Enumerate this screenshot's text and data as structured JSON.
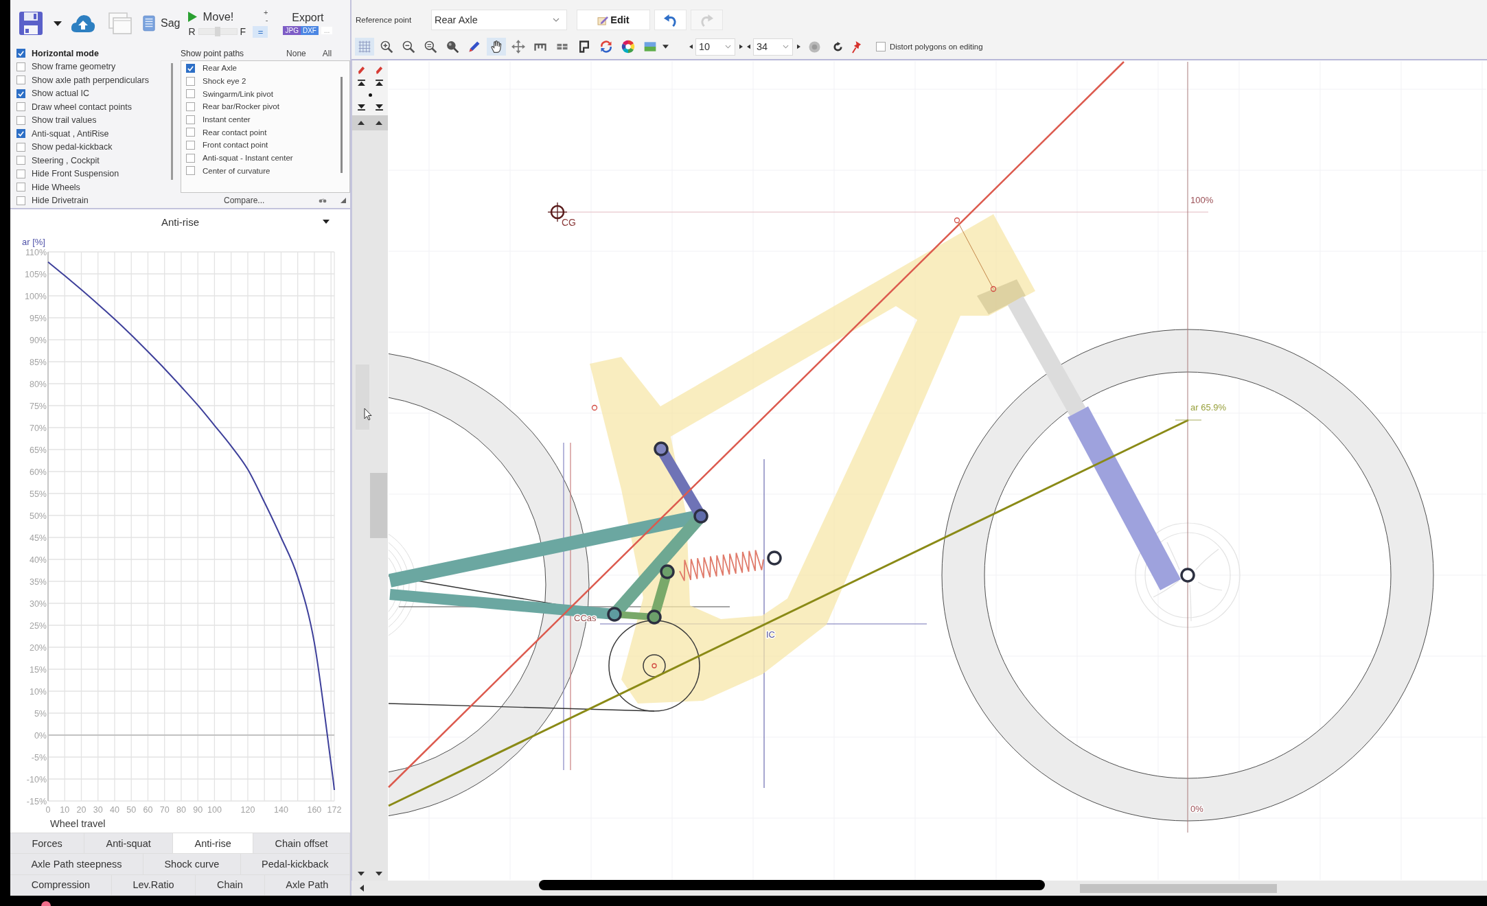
{
  "left_toolbar": {
    "sag_button": "Sag",
    "move_button": "Move!",
    "balance_slider": {
      "left_label": "R",
      "right_label": "F",
      "level": 0.5
    },
    "step_up": "+",
    "step_down": "-",
    "equal_button": "=",
    "export": {
      "label": "Export",
      "formats": [
        {
          "label": "JPG",
          "color": "#7d5cc6"
        },
        {
          "label": "DXF",
          "color": "#4b86e3"
        }
      ],
      "more_button": "..."
    }
  },
  "display_options": [
    {
      "label": "Horizontal mode",
      "checked": true,
      "bold": true
    },
    {
      "label": "Show frame geometry",
      "checked": false,
      "bold": false
    },
    {
      "label": "Show axle path perpendiculars",
      "checked": false,
      "bold": false
    },
    {
      "label": "Show actual IC",
      "checked": true,
      "bold": false
    },
    {
      "label": "Draw wheel contact points",
      "checked": false,
      "bold": false
    },
    {
      "label": "Show trail values",
      "checked": false,
      "bold": false
    },
    {
      "label": "Anti-squat , AntiRise",
      "checked": true,
      "bold": false
    },
    {
      "label": "Show pedal-kickback",
      "checked": false,
      "bold": false
    },
    {
      "label": "Steering , Cockpit",
      "checked": false,
      "bold": false
    },
    {
      "label": "Hide Front Suspension",
      "checked": false,
      "bold": false
    },
    {
      "label": "Hide Wheels",
      "checked": false,
      "bold": false
    },
    {
      "label": "Hide Drivetrain",
      "checked": false,
      "bold": false
    }
  ],
  "point_paths": {
    "title": "Show point paths",
    "none_button": "None",
    "all_button": "All",
    "items": [
      {
        "label": "Rear Axle",
        "checked": true
      },
      {
        "label": "Shock eye 2",
        "checked": false
      },
      {
        "label": "Swingarm/Link pivot",
        "checked": false
      },
      {
        "label": "Rear bar/Rocker pivot",
        "checked": false
      },
      {
        "label": "Instant center",
        "checked": false
      },
      {
        "label": "Rear contact point",
        "checked": false
      },
      {
        "label": "Front contact point",
        "checked": false
      },
      {
        "label": "Anti-squat - Instant center",
        "checked": false
      },
      {
        "label": "Center of curvature",
        "checked": false
      }
    ],
    "compare_button": "Compare..."
  },
  "reference_point": {
    "label": "Reference point",
    "value": "Rear Axle"
  },
  "edit_button": "Edit",
  "history_buttons": [
    {
      "kind": "undo",
      "disabled": false
    },
    {
      "kind": "redo",
      "disabled": true
    }
  ],
  "view_tools": [
    {
      "kind": "grid",
      "selected": true
    },
    {
      "kind": "zoomin",
      "selected": false
    },
    {
      "kind": "zoomout",
      "selected": false
    },
    {
      "kind": "zoomfit",
      "selected": false
    },
    {
      "kind": "zoomall",
      "selected": false
    },
    {
      "kind": "brush",
      "selected": false
    },
    {
      "kind": "hand",
      "selected": true
    },
    {
      "kind": "move",
      "selected": false
    },
    {
      "kind": "ruler",
      "selected": false
    },
    {
      "kind": "tiles",
      "selected": false
    },
    {
      "kind": "pattern",
      "selected": false
    },
    {
      "kind": "rotate",
      "selected": false
    },
    {
      "kind": "palette",
      "selected": false
    },
    {
      "kind": "image",
      "selected": false
    }
  ],
  "spin_fields": [
    {
      "value": "10"
    },
    {
      "value": "34"
    }
  ],
  "distort_polygons": {
    "label": "Distort polygons on editing",
    "checked": false
  },
  "graph_panel": {
    "chart_data": {
      "type": "line",
      "title": "Anti-rise",
      "xlabel": "Wheel travel",
      "ylabel": "ar [%]",
      "grid": true,
      "x": [
        0,
        10,
        20,
        30,
        40,
        50,
        60,
        70,
        80,
        90,
        100,
        110,
        120,
        130,
        140,
        150,
        160,
        170,
        172
      ],
      "values": [
        107.7,
        104.6,
        101.4,
        98.1,
        94.7,
        91.1,
        87.3,
        83.4,
        79.3,
        75.1,
        70.5,
        65.8,
        60.5,
        53,
        45,
        36,
        21,
        -6.5,
        -12.5
      ],
      "xlim": [
        0,
        172
      ],
      "ylim": [
        -15,
        110
      ],
      "xticks": [
        0,
        10,
        20,
        30,
        40,
        50,
        60,
        70,
        80,
        90,
        100,
        120,
        140,
        160,
        172
      ],
      "yticks": [
        {
          "value": 110,
          "label": "110%"
        },
        {
          "value": 105,
          "label": "105%"
        },
        {
          "value": 100,
          "label": "100%"
        },
        {
          "value": 95,
          "label": "95%"
        },
        {
          "value": 90,
          "label": "90%"
        },
        {
          "value": 85,
          "label": "85%"
        },
        {
          "value": 80,
          "label": "80%"
        },
        {
          "value": 75,
          "label": "75%"
        },
        {
          "value": 70,
          "label": "70%"
        },
        {
          "value": 65,
          "label": "65%"
        },
        {
          "value": 60,
          "label": "60%"
        },
        {
          "value": 55,
          "label": "55%"
        },
        {
          "value": 50,
          "label": "50%"
        },
        {
          "value": 45,
          "label": "45%"
        },
        {
          "value": 40,
          "label": "40%"
        },
        {
          "value": 35,
          "label": "35%"
        },
        {
          "value": 30,
          "label": "30%"
        },
        {
          "value": 25,
          "label": "25%"
        },
        {
          "value": 20,
          "label": "20%"
        },
        {
          "value": 15,
          "label": "15%"
        },
        {
          "value": 10,
          "label": "10%"
        },
        {
          "value": 5,
          "label": "5%"
        },
        {
          "value": 0,
          "label": "0%"
        },
        {
          "value": -5,
          "label": "-5%"
        },
        {
          "value": -10,
          "label": "-10%"
        },
        {
          "value": -15,
          "label": "-15%"
        }
      ]
    }
  },
  "graph_tabs": [
    {
      "tabs": [
        {
          "label": "Forces",
          "selected": false
        },
        {
          "label": "Anti-squat",
          "selected": false
        },
        {
          "label": "Anti-rise",
          "selected": true
        },
        {
          "label": "Chain offset",
          "selected": false
        }
      ]
    },
    {
      "tabs": [
        {
          "label": "Axle Path steepness",
          "selected": false
        },
        {
          "label": "Shock curve",
          "selected": false
        },
        {
          "label": "Pedal-kickback",
          "selected": false
        }
      ]
    },
    {
      "tabs": [
        {
          "label": "Compression",
          "selected": false
        },
        {
          "label": "Lev.Ratio",
          "selected": false
        },
        {
          "label": "Chain",
          "selected": false
        },
        {
          "label": "Axle Path",
          "selected": false
        }
      ]
    }
  ],
  "canvas": {
    "labels": [
      {
        "kind": "cg",
        "text": "CG"
      },
      {
        "kind": "top",
        "text": "100%"
      },
      {
        "kind": "antirise",
        "text": "ar 65.9%"
      },
      {
        "kind": "bottom",
        "text": "0%"
      },
      {
        "kind": "cc",
        "text": "CCas"
      },
      {
        "kind": "ic",
        "text": "IC"
      }
    ]
  }
}
